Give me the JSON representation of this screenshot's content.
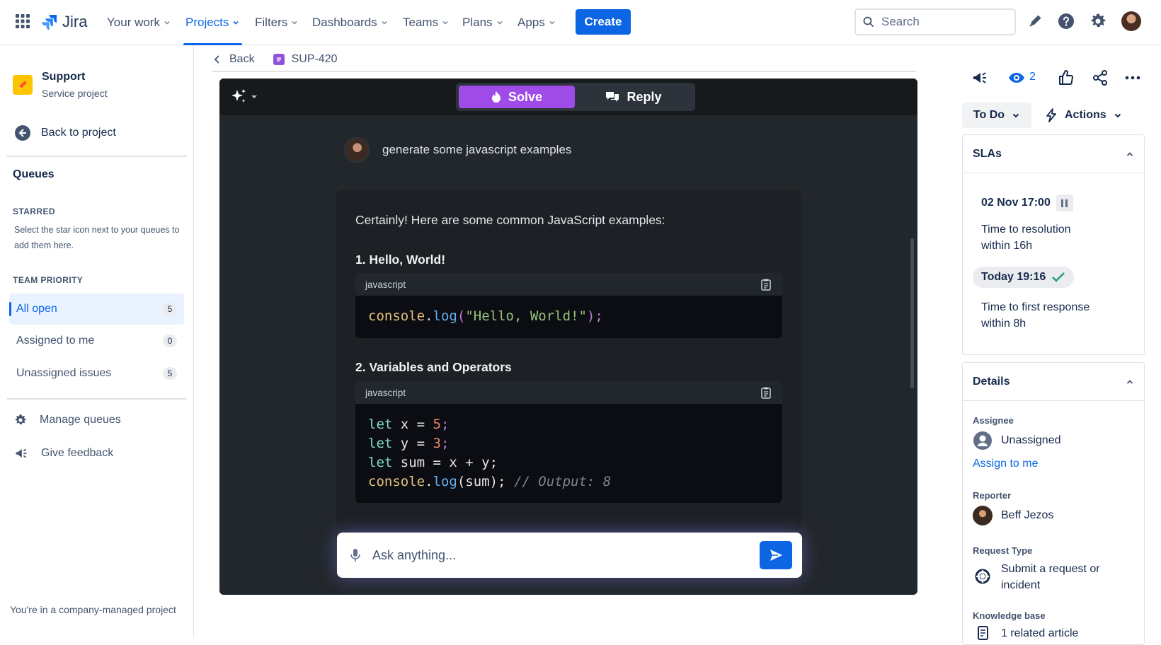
{
  "nav": {
    "app_name": "Jira",
    "items": [
      {
        "label": "Your work"
      },
      {
        "label": "Projects"
      },
      {
        "label": "Filters"
      },
      {
        "label": "Dashboards"
      },
      {
        "label": "Teams"
      },
      {
        "label": "Plans"
      },
      {
        "label": "Apps"
      }
    ],
    "create_label": "Create",
    "search_placeholder": "Search"
  },
  "sidebar": {
    "project_name": "Support",
    "project_type": "Service project",
    "back_label": "Back to project",
    "queues_heading": "Queues",
    "starred_heading": "STARRED",
    "starred_note": "Select the star icon next to your queues to add them here.",
    "team_priority_heading": "TEAM PRIORITY",
    "queues": [
      {
        "label": "All open",
        "count": "5"
      },
      {
        "label": "Assigned to me",
        "count": "0"
      },
      {
        "label": "Unassigned issues",
        "count": "5"
      }
    ],
    "manage_label": "Manage queues",
    "feedback_label": "Give feedback",
    "footer": "You're in a company-managed project"
  },
  "breadcrumb": {
    "back_label": "Back",
    "issue_key": "SUP-420"
  },
  "assistant": {
    "solve_label": "Solve",
    "reply_label": "Reply",
    "prompt": "generate some javascript examples",
    "intro": "Certainly! Here are some common JavaScript examples:",
    "section1_title": "1. Hello, World!",
    "section1_lang": "javascript",
    "section2_title": "2. Variables and Operators",
    "section2_lang": "javascript",
    "code1": {
      "obj": "console",
      "dot": ".",
      "fn": "log",
      "open": "(",
      "str": "\"Hello, World!\"",
      "close": ");"
    },
    "code2": {
      "l1_kw": "let",
      "l1_rest": " x = ",
      "l1_num": "5",
      "l1_end": ";",
      "l2_kw": "let",
      "l2_rest": " y = ",
      "l2_num": "3",
      "l2_end": ";",
      "l3_kw": "let",
      "l3_rest": " sum = x + y;",
      "l4_obj": "console",
      "l4_dot": ".",
      "l4_fn": "log",
      "l4_args": "(sum);",
      "l4_comment": " // Output: 8"
    },
    "input_placeholder": "Ask anything..."
  },
  "right": {
    "watchers_count": "2",
    "status_label": "To Do",
    "actions_label": "Actions",
    "slas": {
      "heading": "SLAs",
      "items": [
        {
          "time": "02 Nov 17:00",
          "name": "Time to resolution",
          "goal": "within 16h"
        },
        {
          "time": "Today 19:16",
          "name": "Time to first response",
          "goal": "within 8h"
        }
      ]
    },
    "details": {
      "heading": "Details",
      "assignee_label": "Assignee",
      "assignee_value": "Unassigned",
      "assign_link": "Assign to me",
      "reporter_label": "Reporter",
      "reporter_value": "Beff Jezos",
      "request_type_label": "Request Type",
      "request_type_line1": "Submit a request or",
      "request_type_line2": "incident",
      "kb_label": "Knowledge base",
      "kb_value": "1 related article"
    }
  },
  "colors": {
    "brand": "#0C66E4",
    "solve": "#9F4BE8",
    "panel_bg": "#22272B"
  }
}
